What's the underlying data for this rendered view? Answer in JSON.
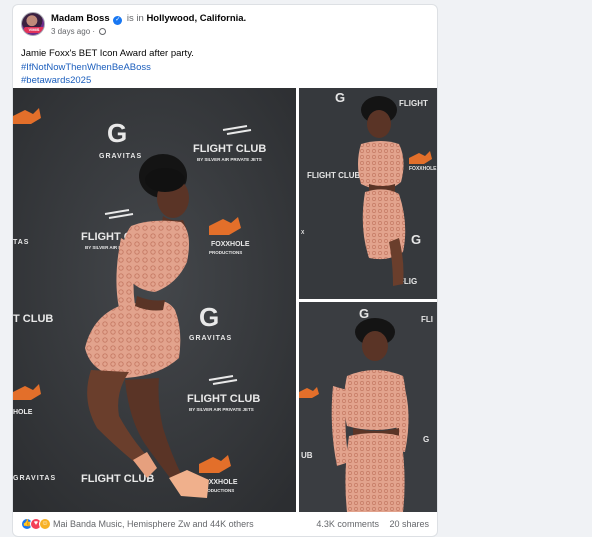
{
  "post": {
    "author": "Madam Boss",
    "avatar_label": "VIMIS",
    "in_label": "is in",
    "location": "Hollywood, California.",
    "time": "3 days ago",
    "dot": "·",
    "caption": "Jamie Foxx's BET Icon Award  after party.",
    "hashtags": [
      "#IfNotNowThenWhenBeABoss",
      "#betawards2025"
    ]
  },
  "backdrop": {
    "brand1": "GRAVITAS",
    "brand2": "FLIGHT CLUB",
    "brand2_sub": "BY SILVER AIR PRIVATE JETS",
    "brand3": "FOXXHOLE",
    "brand3_sub": "PRODUCTIONS",
    "brand4": "HOLE"
  },
  "footer": {
    "reactions": [
      "like",
      "love",
      "care"
    ],
    "reaction_names": "Mai Banda Music, Hemisphere Zw and 44K others",
    "comments": "4.3K comments",
    "shares": "20 shares"
  },
  "colors": {
    "link": "#1b5ebd",
    "verified": "#1877f2",
    "backdrop": "#3b3e42",
    "dress": "#e8a48c",
    "fox": "#e36f2a"
  }
}
